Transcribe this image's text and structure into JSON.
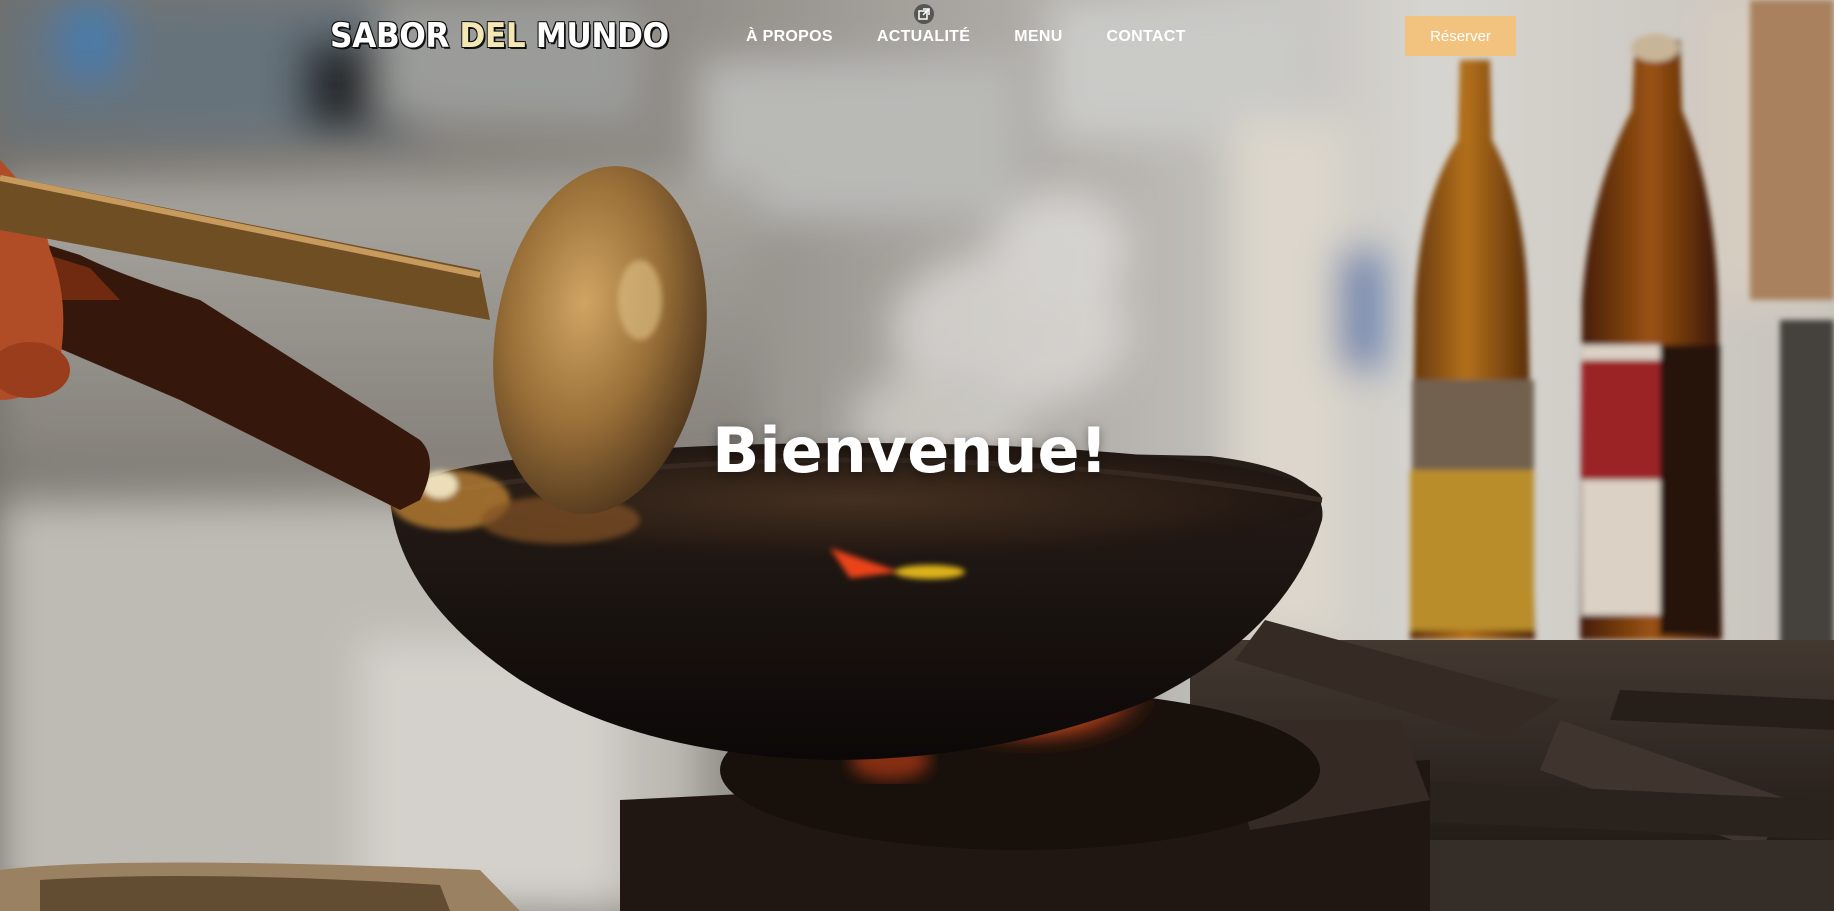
{
  "header": {
    "logo": {
      "part1": "SABOR ",
      "part2": "DEL",
      "part3": " MUNDO"
    },
    "nav": [
      {
        "label": "À PROPOS"
      },
      {
        "label": "ACTUALITÉ",
        "icon": "external-link-icon"
      },
      {
        "label": "MENU"
      },
      {
        "label": "CONTACT"
      }
    ],
    "reserve_label": "Réserver"
  },
  "hero": {
    "title": "Bienvenue!",
    "background": "kitchen-wok-photo"
  },
  "colors": {
    "reserve_button": "#f2c27f",
    "logo_accent": "#f3e7b3",
    "text": "#ffffff"
  }
}
